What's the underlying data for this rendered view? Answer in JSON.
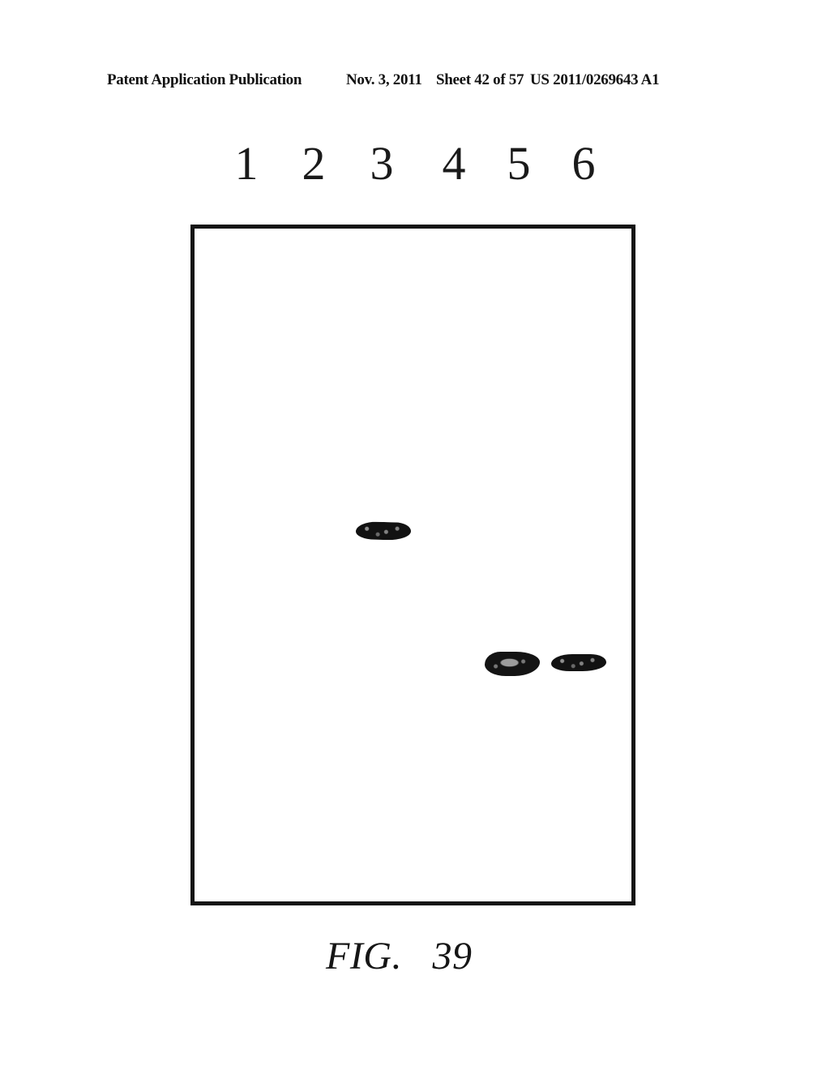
{
  "header": {
    "publication_type": "Patent Application Publication",
    "date": "Nov. 3, 2011",
    "sheet": "Sheet 42 of 57",
    "publication_number": "US 2011/0269643 A1"
  },
  "figure": {
    "type": "gel-blot",
    "lane_labels": [
      "1",
      "2",
      "3",
      "4",
      "5",
      "6"
    ],
    "bands": [
      {
        "lane": "3",
        "relative_position": "middle"
      },
      {
        "lane": "5",
        "relative_position": "lower"
      },
      {
        "lane": "6",
        "relative_position": "lower"
      }
    ],
    "caption": "FIG.   39"
  }
}
